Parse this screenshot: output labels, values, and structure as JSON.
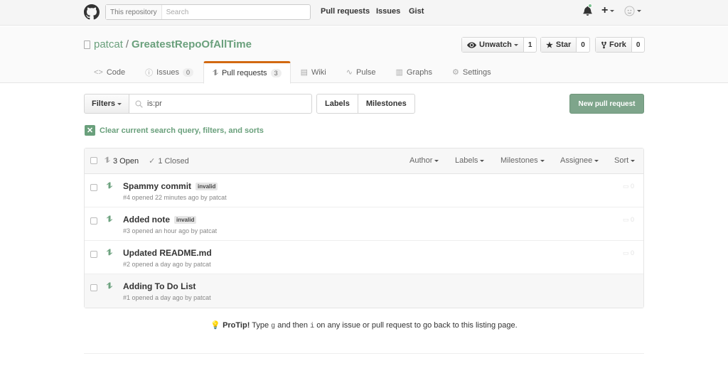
{
  "header": {
    "logo_icon": "github-octocat-icon",
    "search_scope": "This repository",
    "search_placeholder": "Search",
    "nav": [
      "Pull requests",
      "Issues",
      "Gist"
    ],
    "right_icons": [
      "bell-icon",
      "plus-icon",
      "avatar"
    ]
  },
  "repo": {
    "owner": "patcat",
    "separator": "/",
    "name": "GreatestRepoOfAllTime",
    "unwatch_label": "Unwatch",
    "unwatch_count": "1",
    "star_label": "Star",
    "star_count": "0",
    "fork_label": "Fork",
    "fork_count": "0"
  },
  "tabs": [
    {
      "label": "Code",
      "icon": "code-icon"
    },
    {
      "label": "Issues",
      "icon": "issue-icon",
      "count": "0"
    },
    {
      "label": "Pull requests",
      "icon": "pull-request-icon",
      "count": "3",
      "selected": true
    },
    {
      "label": "Wiki",
      "icon": "book-icon"
    },
    {
      "label": "Pulse",
      "icon": "pulse-icon"
    },
    {
      "label": "Graphs",
      "icon": "graph-icon"
    },
    {
      "label": "Settings",
      "icon": "gear-icon"
    }
  ],
  "subnav": {
    "filters_label": "Filters",
    "query": "is:pr",
    "labels_label": "Labels",
    "milestones_label": "Milestones",
    "new_pr_label": "New pull request"
  },
  "clear_query": "Clear current search query, filters, and sorts",
  "table": {
    "open_label": "3 Open",
    "closed_label": "1 Closed",
    "filters": [
      "Author",
      "Labels",
      "Milestones",
      "Assignee",
      "Sort"
    ],
    "rows": [
      {
        "title": "Spammy commit",
        "label": "invalid",
        "meta": "#4 opened 22 minutes ago by patcat",
        "comments": "0"
      },
      {
        "title": "Added note",
        "label": "invalid",
        "meta": "#3 opened an hour ago by patcat",
        "comments": "0"
      },
      {
        "title": "Updated README.md",
        "label": "",
        "meta": "#2 opened a day ago by patcat",
        "comments": "0"
      },
      {
        "title": "Adding To Do List",
        "label": "",
        "meta": "#1 opened a day ago by patcat",
        "comments": ""
      }
    ]
  },
  "protip": {
    "strong": "ProTip!",
    "text1": "Type",
    "key1": "g",
    "text2": "and then",
    "key2": "i",
    "text3": "on any issue or pull request to go back to this listing page."
  },
  "colors": {
    "accent_green": "#6aa07c",
    "new_pr_bg": "#7ea58b",
    "selected_tab_border": "#d26911"
  }
}
